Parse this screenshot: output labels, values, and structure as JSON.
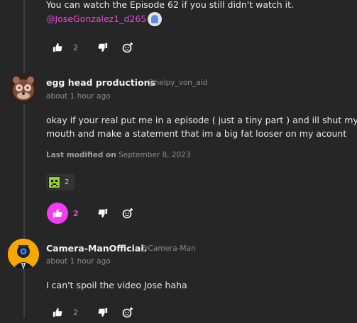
{
  "previous_comment": {
    "text_line": "You can watch the Episode 62 if you still didn't watch it.",
    "mention": "@JoseGonzalez1_d265",
    "upvotes": "2"
  },
  "comments": [
    {
      "author": "egg head productions",
      "handle": "@helpy_von_aid",
      "time": "about 1 hour ago",
      "lines": [
        "okay if your real put me in a episode ( just a tiny part ) and ill shut my",
        "mouth and make a statement that im a big fat looser on my acount"
      ],
      "modified_label": "Last modified on",
      "modified_date": "September 8, 2023",
      "reaction_count": "2",
      "upvotes": "2"
    },
    {
      "author": "Camera-ManOfficial.",
      "handle": "@Camera-Man",
      "time": "about 1 hour ago",
      "lines": [
        "I can't spoil the video Jose haha"
      ],
      "upvotes": "2"
    }
  ],
  "colors": {
    "accent": "#f23df2",
    "background": "#262626"
  }
}
